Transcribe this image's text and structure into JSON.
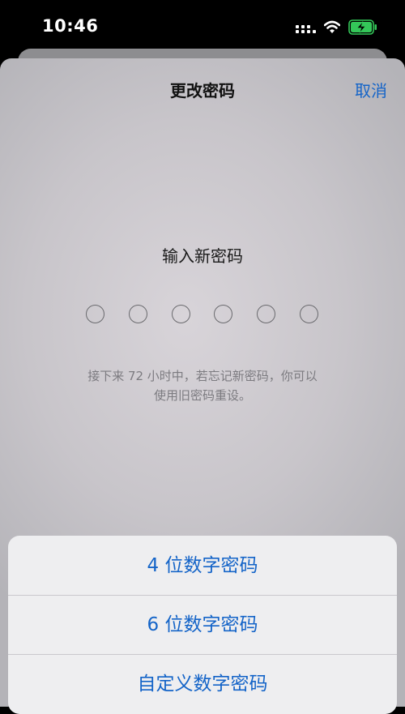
{
  "status_bar": {
    "time": "10:46",
    "icons": [
      "cellular-signal-icon",
      "wifi-icon",
      "battery-charging-icon"
    ],
    "battery_color": "#34c759"
  },
  "sheet": {
    "title": "更改密码",
    "cancel_label": "取消",
    "prompt": "输入新密码",
    "passcode_length": 6,
    "hint_line1": "接下来 72 小时中，若忘记新密码，你可以",
    "hint_line2": "使用旧密码重设。"
  },
  "action_sheet": {
    "items": [
      {
        "label": "4 位数字密码"
      },
      {
        "label": "6 位数字密码"
      },
      {
        "label": "自定义数字密码"
      }
    ]
  },
  "colors": {
    "accent": "#1464c8",
    "text_primary": "#111111",
    "text_secondary": "#7c7b80"
  }
}
